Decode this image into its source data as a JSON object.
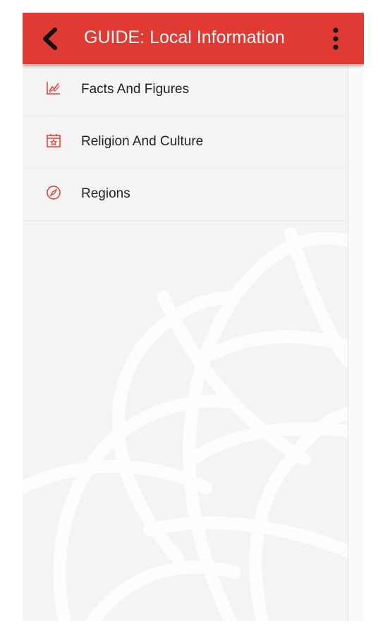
{
  "appbar": {
    "title": "GUIDE: Local Information",
    "back_icon": "chevron-left-icon",
    "menu_icon": "more-vert-icon",
    "color": "#e03a32"
  },
  "menu": {
    "items": [
      {
        "label": "Facts And Figures",
        "icon": "chart-icon"
      },
      {
        "label": "Religion And Culture",
        "icon": "calendar-star-icon"
      },
      {
        "label": "Regions",
        "icon": "compass-icon"
      }
    ]
  },
  "colors": {
    "accent": "#e03a32",
    "background": "#f4f4f4",
    "text": "#222222"
  }
}
